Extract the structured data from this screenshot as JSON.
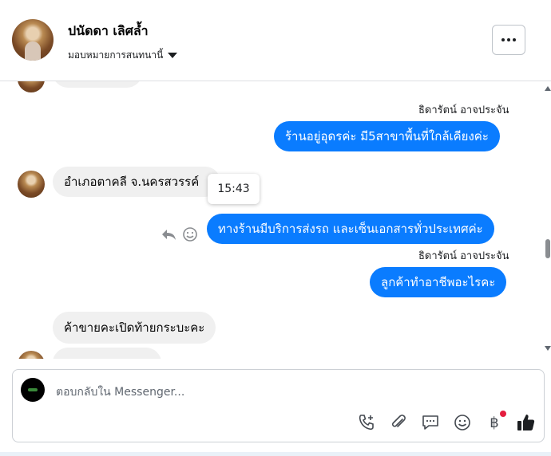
{
  "header": {
    "contact_name": "ปนัดดา เลิศล้ำ",
    "assign_label": "มอบหมายการสนทนานี้"
  },
  "conversation": {
    "messages": [
      {
        "direction": "outgoing",
        "sender": "ธิดารัตน์ อาจประจัน",
        "text": "ร้านอยู่อุดรค่ะ มี5สาขาพื้นที่ใกล้เคียงค่ะ"
      },
      {
        "direction": "incoming",
        "text": "อำเภอตาคลี  จ.นครสวรรค์"
      },
      {
        "direction": "outgoing",
        "text": "ทางร้านมีบริการส่งรถ และเซ็นเอกสารทั่วประเทศค่ะ"
      },
      {
        "direction": "outgoing",
        "sender": "ธิดารัตน์ อาจประจัน",
        "text": "ลูกค้าทำอาชีพอะไรคะ"
      },
      {
        "direction": "incoming",
        "text": "ค้าขายคะเปิดท้ายกระบะคะ"
      }
    ],
    "tooltip_time": "15:43"
  },
  "composer": {
    "placeholder": "ตอบกลับใน Messenger...",
    "baht_symbol": "฿"
  },
  "icons": [
    "chevron-down-icon",
    "more-icon",
    "reply-icon",
    "emoji-icon",
    "add-call-icon",
    "attach-icon",
    "saved-reply-icon",
    "baht-icon",
    "like-icon"
  ],
  "colors": {
    "outgoing_bubble": "#0a7cff",
    "incoming_bubble": "#f0f0f0",
    "notification_dot": "#e41e3f"
  }
}
